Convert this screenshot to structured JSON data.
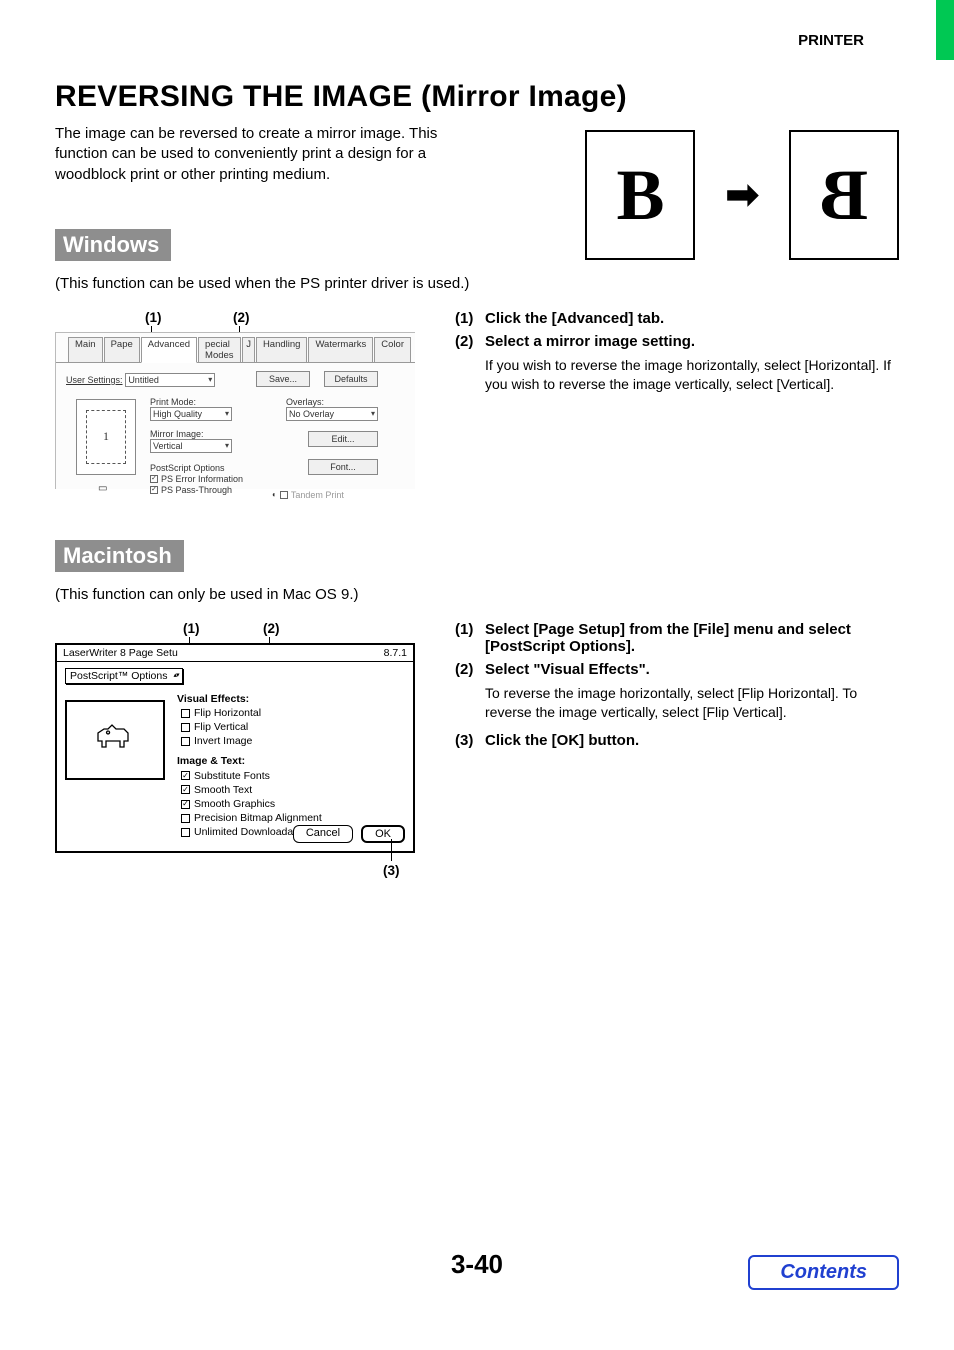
{
  "header": {
    "label": "PRINTER"
  },
  "title": "REVERSING THE IMAGE (Mirror Image)",
  "subtitle": "The image can be reversed to create a mirror image. This function can be used to conveniently print a design for a woodblock print or other printing medium.",
  "mirror_glyph": "B",
  "windows": {
    "label": "Windows",
    "note": "(This function can be used when the PS printer driver is used.)",
    "callouts": {
      "c1": "(1)",
      "c2": "(2)"
    },
    "dialog": {
      "tabs": [
        "Main",
        "Pape",
        "Advanced",
        "pecial Modes",
        "J",
        "Handling",
        "Watermarks",
        "Color"
      ],
      "active_tab": "Advanced",
      "user_settings_label": "User Settings:",
      "user_settings_value": "Untitled",
      "save_btn": "Save...",
      "defaults_btn": "Defaults",
      "print_mode_label": "Print Mode:",
      "print_mode_value": "High Quality",
      "mirror_label": "Mirror Image:",
      "mirror_value": "Vertical",
      "overlays_label": "Overlays:",
      "overlays_value": "No Overlay",
      "edit_btn": "Edit...",
      "font_btn": "Font...",
      "ps_options": "PostScript Options",
      "ps_err": "PS Error Information",
      "ps_pass": "PS Pass-Through",
      "tandem": "Tandem Print",
      "preview_num": "1"
    },
    "instructions": [
      {
        "num": "(1)",
        "heading": "Click the [Advanced] tab."
      },
      {
        "num": "(2)",
        "heading": "Select a mirror image setting.",
        "sub": "If you wish to reverse the image horizontally, select [Horizontal]. If you wish to reverse the image vertically, select [Vertical]."
      }
    ]
  },
  "mac": {
    "label": "Macintosh",
    "note": "(This function can only be used in Mac OS 9.)",
    "callouts": {
      "c1": "(1)",
      "c2": "(2)",
      "c3": "(3)"
    },
    "dialog": {
      "title_left": "LaserWriter 8 Page Setu",
      "title_right": "8.7.1",
      "select_value": "PostScript™ Options",
      "visual_group": "Visual Effects:",
      "flip_h": "Flip Horizontal",
      "flip_v": "Flip Vertical",
      "invert": "Invert Image",
      "imgtxt_group": "Image & Text:",
      "sub_fonts": "Substitute Fonts",
      "smooth_text": "Smooth Text",
      "smooth_gfx": "Smooth Graphics",
      "precision": "Precision Bitmap Alignment",
      "unlimited": "Unlimited Downloadable Fonts",
      "cancel": "Cancel",
      "ok": "OK"
    },
    "instructions": [
      {
        "num": "(1)",
        "heading": "Select [Page Setup] from the [File] menu and select [PostScript Options]."
      },
      {
        "num": "(2)",
        "heading": "Select \"Visual Effects\".",
        "sub": "To reverse the image horizontally, select [Flip Horizontal]. To reverse the image vertically, select [Flip Vertical]."
      },
      {
        "num": "(3)",
        "heading": "Click the [OK] button."
      }
    ]
  },
  "page_number": "3-40",
  "contents_label": "Contents"
}
